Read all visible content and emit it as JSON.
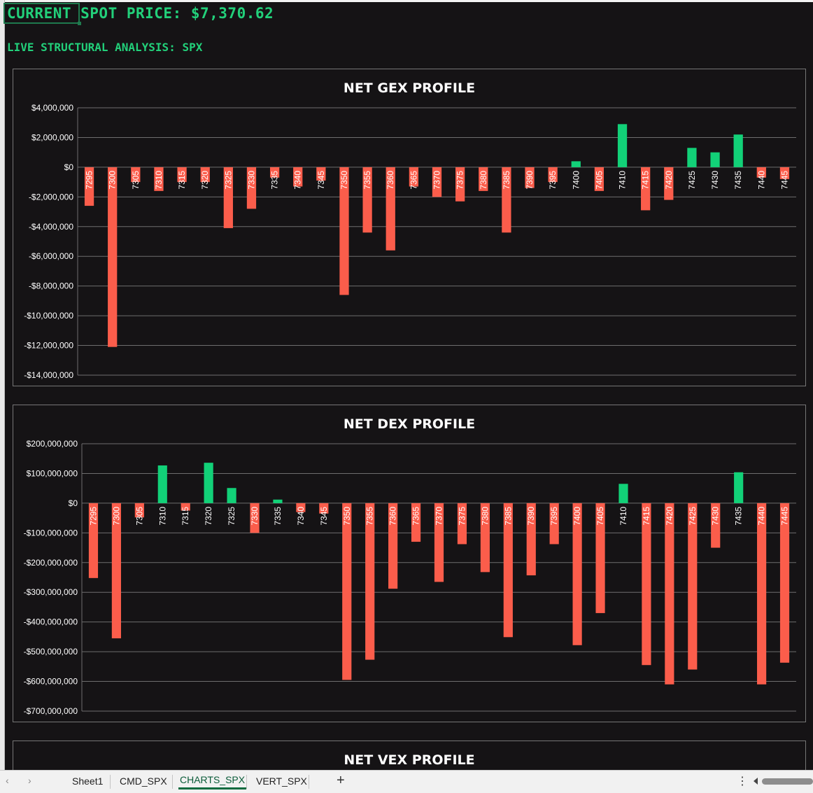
{
  "header": {
    "spot_text": "CURRENT SPOT PRICE: $7,370.62",
    "subtitle": "LIVE STRUCTURAL ANALYSIS: SPX"
  },
  "colors": {
    "positive": "#12d178",
    "negative": "#fb5d4b",
    "text_green": "#22d07a",
    "background": "#151315",
    "gridline": "#6e6e6e"
  },
  "tabs": [
    {
      "label": "Sheet1",
      "active": false
    },
    {
      "label": "CMD_SPX",
      "active": false
    },
    {
      "label": "CHARTS_SPX",
      "active": true
    },
    {
      "label": "VERT_SPX",
      "active": false
    }
  ],
  "tabbar": {
    "add_sheet": "+",
    "more_menu": "⋮",
    "prev_icon": "chevron-left-icon",
    "next_icon": "chevron-right-icon"
  },
  "chart_data": [
    {
      "type": "bar",
      "title": "NET GEX PROFILE",
      "xlabel": "",
      "ylabel": "",
      "ylim": [
        -14000000,
        4000000
      ],
      "ytick_step": 2000000,
      "yticks": [
        "$4,000,000",
        "$2,000,000",
        "$0",
        "-$2,000,000",
        "-$4,000,000",
        "-$6,000,000",
        "-$8,000,000",
        "-$10,000,000",
        "-$12,000,000",
        "-$14,000,000"
      ],
      "grid": true,
      "legend": "none",
      "categories": [
        "7295",
        "7300",
        "7305",
        "7310",
        "7315",
        "7320",
        "7325",
        "7330",
        "7335",
        "7340",
        "7345",
        "7350",
        "7355",
        "7360",
        "7365",
        "7370",
        "7375",
        "7380",
        "7385",
        "7390",
        "7395",
        "7400",
        "7405",
        "7410",
        "7415",
        "7420",
        "7425",
        "7430",
        "7435",
        "7440",
        "7445"
      ],
      "values": [
        -2600000,
        -12100000,
        -1000000,
        -1600000,
        -1000000,
        -1000000,
        -4100000,
        -2800000,
        -700000,
        -1300000,
        -900000,
        -8600000,
        -4400000,
        -5600000,
        -1300000,
        -2000000,
        -2300000,
        -1600000,
        -4400000,
        -1400000,
        -1000000,
        400000,
        -1600000,
        2900000,
        -2900000,
        -2200000,
        1300000,
        1000000,
        2200000,
        -700000,
        -800000
      ]
    },
    {
      "type": "bar",
      "title": "NET DEX PROFILE",
      "xlabel": "",
      "ylabel": "",
      "ylim": [
        -700000000,
        200000000
      ],
      "ytick_step": 100000000,
      "yticks": [
        "$200,000,000",
        "$100,000,000",
        "$0",
        "-$100,000,000",
        "-$200,000,000",
        "-$300,000,000",
        "-$400,000,000",
        "-$500,000,000",
        "-$600,000,000",
        "-$700,000,000"
      ],
      "grid": true,
      "legend": "none",
      "categories": [
        "7295",
        "7300",
        "7305",
        "7310",
        "7315",
        "7320",
        "7325",
        "7330",
        "7335",
        "7340",
        "7345",
        "7350",
        "7355",
        "7360",
        "7365",
        "7370",
        "7375",
        "7380",
        "7385",
        "7390",
        "7395",
        "7400",
        "7405",
        "7410",
        "7415",
        "7420",
        "7425",
        "7430",
        "7435",
        "7440",
        "7445"
      ],
      "values": [
        -252000000,
        -455000000,
        -48000000,
        127000000,
        -25000000,
        136000000,
        51000000,
        -100000000,
        12000000,
        -30000000,
        -35000000,
        -595000000,
        -527000000,
        -288000000,
        -130000000,
        -265000000,
        -138000000,
        -232000000,
        -451000000,
        -243000000,
        -138000000,
        -478000000,
        -370000000,
        65000000,
        -545000000,
        -610000000,
        -560000000,
        -150000000,
        104000000,
        -610000000,
        -537000000
      ]
    },
    {
      "type": "bar",
      "title": "NET VEX PROFILE"
    }
  ]
}
